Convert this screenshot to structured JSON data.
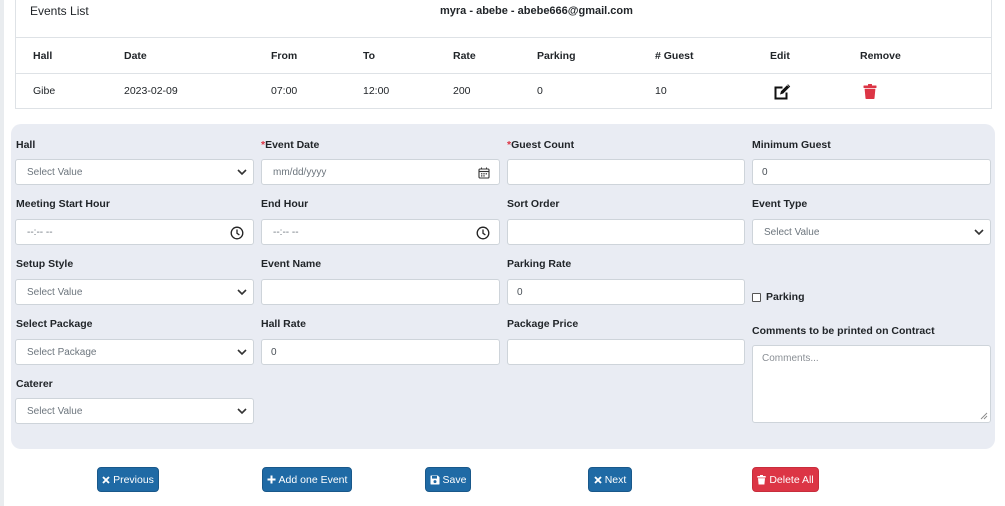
{
  "events_list": {
    "title": "Events List",
    "user": "myra - abebe - abebe666@gmail.com",
    "columns": [
      "Hall",
      "Date",
      "From",
      "To",
      "Rate",
      "Parking",
      "# Guest",
      "Edit",
      "Remove"
    ],
    "rows": [
      {
        "hall": "Gibe",
        "date": "2023-02-09",
        "from": "07:00",
        "to": "12:00",
        "rate": "200",
        "parking": "0",
        "guests": "10",
        "edit_icon": "edit-icon",
        "remove_icon": "trash-icon"
      }
    ]
  },
  "form": {
    "hall": {
      "label": "Hall",
      "value": "Select Value"
    },
    "event_date": {
      "required_mark": "*",
      "label": "Event Date",
      "placeholder": "mm/dd/yyyy",
      "icon": "calendar-icon"
    },
    "guest_count": {
      "required_mark": "*",
      "label": "Guest Count",
      "value": ""
    },
    "minimum_guest": {
      "label": "Minimum Guest",
      "value": "0"
    },
    "meeting_start_hour": {
      "label": "Meeting Start Hour",
      "placeholder": "--:-- --",
      "icon": "clock-icon"
    },
    "end_hour": {
      "label": "End Hour",
      "placeholder": "--:-- --",
      "icon": "clock-icon"
    },
    "sort_order": {
      "label": "Sort Order",
      "value": ""
    },
    "event_type": {
      "label": "Event Type",
      "value": "Select Value"
    },
    "setup_style": {
      "label": "Setup Style",
      "value": "Select Value"
    },
    "event_name": {
      "label": "Event Name",
      "value": ""
    },
    "parking_rate": {
      "label": "Parking Rate",
      "value": "0"
    },
    "parking": {
      "label": "Parking",
      "checked": false
    },
    "select_package": {
      "label": "Select Package",
      "value": "Select Package"
    },
    "hall_rate": {
      "label": "Hall Rate",
      "value": "0"
    },
    "package_price": {
      "label": "Package Price",
      "value": ""
    },
    "comments": {
      "label": "Comments to be printed on Contract",
      "placeholder": "Comments..."
    },
    "caterer": {
      "label": "Caterer",
      "value": "Select Value"
    }
  },
  "buttons": {
    "previous": {
      "label": "Previous",
      "icon": "close-icon"
    },
    "add_event": {
      "label": "Add one Event",
      "icon": "plus-icon"
    },
    "save": {
      "label": "Save",
      "icon": "floppy-disk-icon"
    },
    "next": {
      "label": "Next",
      "icon": "close-icon"
    },
    "delete_all": {
      "label": "Delete All",
      "icon": "trash-icon"
    }
  },
  "colors": {
    "primary": "#1f6aa5",
    "danger": "#dc3545",
    "panel": "#e9ecf3",
    "required": "#dc3545"
  }
}
